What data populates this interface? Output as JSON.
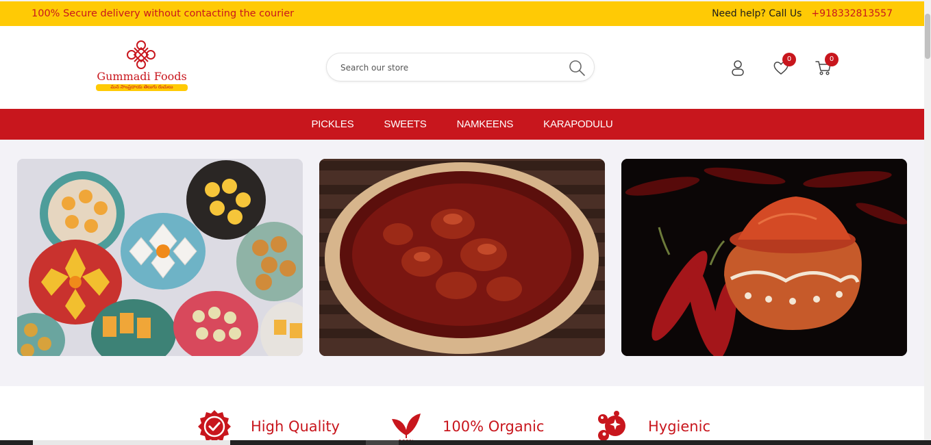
{
  "topbar": {
    "message": "100% Secure delivery without contacting the courier",
    "help_label": "Need help? Call Us",
    "phone": "+918332813557"
  },
  "header": {
    "logo": {
      "brand": "Gummadi Foods",
      "tagline": "మన సాంప్రదాయ తెలుగు రుచులు"
    },
    "search": {
      "placeholder": "Search our store"
    },
    "wishlist_count": "0",
    "cart_count": "0"
  },
  "nav": {
    "items": [
      {
        "label": "PICKLES"
      },
      {
        "label": "SWEETS"
      },
      {
        "label": "NAMKEENS"
      },
      {
        "label": "KARAPODULU"
      }
    ]
  },
  "features": [
    {
      "label": "High Quality",
      "icon": "quality-badge-icon"
    },
    {
      "label": "100% Organic",
      "icon": "organic-leaf-icon"
    },
    {
      "label": "Hygienic",
      "icon": "hygienic-bubbles-icon"
    }
  ],
  "colors": {
    "brand_red": "#c8161d",
    "top_yellow": "#ffca05",
    "page_bg": "#f3f2f7"
  }
}
